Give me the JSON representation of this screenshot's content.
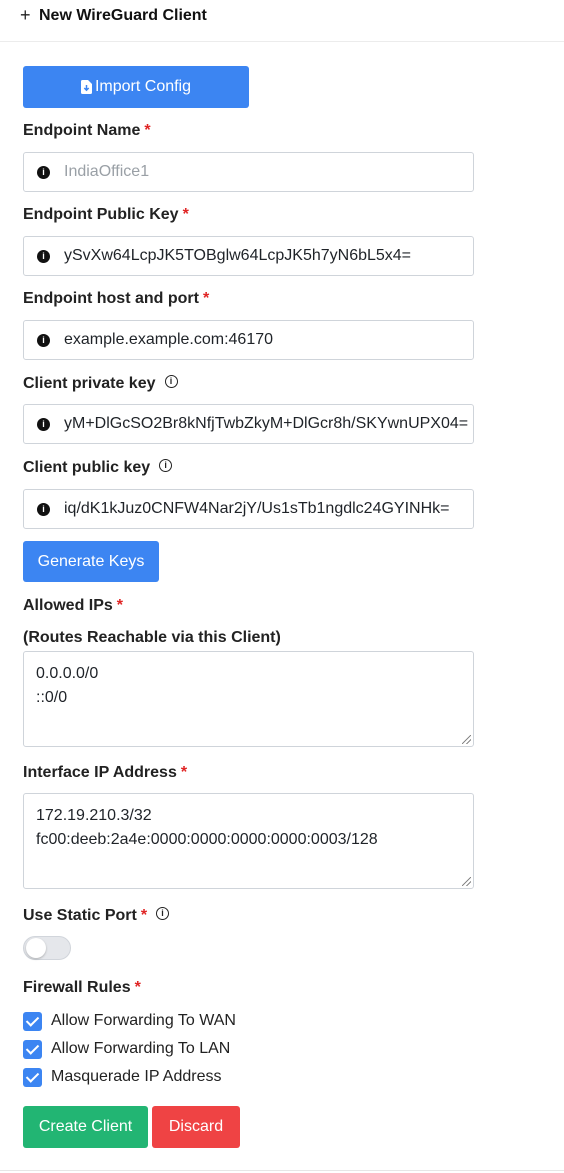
{
  "header": {
    "plus": "+",
    "title": "New WireGuard Client"
  },
  "import_button": {
    "label": "Import Config"
  },
  "fields": {
    "endpoint_name": {
      "label": "Endpoint Name",
      "value": "",
      "placeholder": "IndiaOffice1"
    },
    "endpoint_public_key": {
      "label": "Endpoint Public Key",
      "value": "ySvXw64LcpJK5TOBglw64LcpJK5h7yN6bL5x4="
    },
    "endpoint_host_port": {
      "label": "Endpoint host and port",
      "value": "example.example.com:46170"
    },
    "client_private_key": {
      "label": "Client private key",
      "value": "yM+DlGcSO2Br8kNfjTwbZkyM+DlGcr8h/SKYwnUPX04="
    },
    "client_public_key": {
      "label": "Client public key",
      "value": "iq/dK1kJuz0CNFW4Nar2jY/Us1sTb1ngdlc24GYINHk="
    }
  },
  "generate_keys": {
    "label": "Generate Keys"
  },
  "allowed_ips": {
    "label": "Allowed IPs",
    "sublabel": "(Routes Reachable via this Client)",
    "lines": [
      "0.0.0.0/0",
      "::0/0"
    ]
  },
  "interface_ip": {
    "label": "Interface IP Address",
    "lines": [
      "172.19.210.3/32",
      "fc00:deeb:2a4e:0000:0000:0000:0000:0003/128"
    ]
  },
  "static_port": {
    "label": "Use Static Port",
    "enabled": false
  },
  "firewall": {
    "label": "Firewall Rules",
    "rules": [
      {
        "label": "Allow Forwarding To WAN",
        "checked": true
      },
      {
        "label": "Allow Forwarding To LAN",
        "checked": true
      },
      {
        "label": "Masquerade IP Address",
        "checked": true
      }
    ]
  },
  "actions": {
    "create": "Create Client",
    "discard": "Discard"
  },
  "required_mark": "*",
  "info_glyph": "i",
  "colors": {
    "primary": "#3c85f2",
    "success": "#22b573",
    "danger": "#ef4344",
    "required": "#e02424"
  }
}
